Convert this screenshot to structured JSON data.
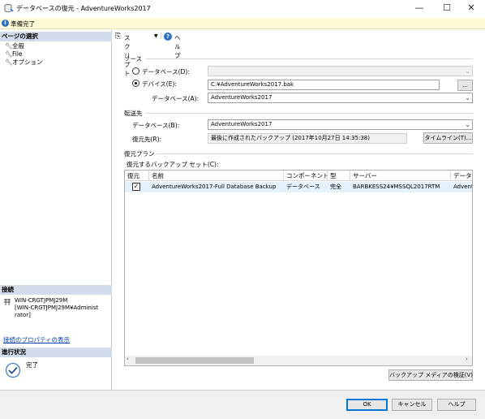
{
  "window": {
    "title": "データベースの復元 - AdventureWorks2017",
    "minimize": "—",
    "maximize": "☐",
    "close": "✕"
  },
  "status": {
    "text": "準備完了"
  },
  "left": {
    "page_select_header": "ページの選択",
    "pages": [
      {
        "label": "全般"
      },
      {
        "label": "File"
      },
      {
        "label": "オプション"
      }
    ],
    "connection_header": "接続",
    "connection_server": "WIN-CRGTJPMJ29M",
    "connection_user_line1": "[WIN-CRGTJPMJ29M¥Administ",
    "connection_user_line2": "rator]",
    "connection_link": "接続のプロパティの表示",
    "progress_header": "進行状況",
    "progress_status": "完了"
  },
  "toolbar": {
    "script_label": "スクリプト",
    "help_label": "ヘルプ"
  },
  "source": {
    "group_label": "ソース",
    "database_radio_label": "データベース(D):",
    "device_radio_label": "デバイス(E):",
    "device_value": "C:¥AdventureWorks2017.bak",
    "browse_label": "...",
    "database_label": "データベース(A):",
    "database_value": "AdventureWorks2017"
  },
  "destination": {
    "group_label": "転送先",
    "database_label": "データベース(B):",
    "database_value": "AdventureWorks2017",
    "restore_to_label": "復元先(R):",
    "restore_to_value": "最後に作成されたバックアップ (2017年10月27日 14:35:38)",
    "timeline_label": "タイムライン(T)..."
  },
  "plan": {
    "group_label": "復元プラン",
    "sets_label": "復元するバックアップ セット(C):",
    "columns": [
      "復元",
      "名前",
      "コンポーネント",
      "型",
      "サーバー",
      "データベ"
    ],
    "rows": [
      {
        "restore": true,
        "name": "AdventureWorks2017-Full Database Backup",
        "component": "データベース",
        "type": "完全",
        "server": "BARBKESS24¥MSSQL2017RTM",
        "database": "Advent"
      }
    ],
    "verify_label": "バックアップ メディアの検証(V)"
  },
  "footer": {
    "ok_label": "OK",
    "cancel_label": "キャンセル",
    "help_label": "ヘルプ"
  }
}
